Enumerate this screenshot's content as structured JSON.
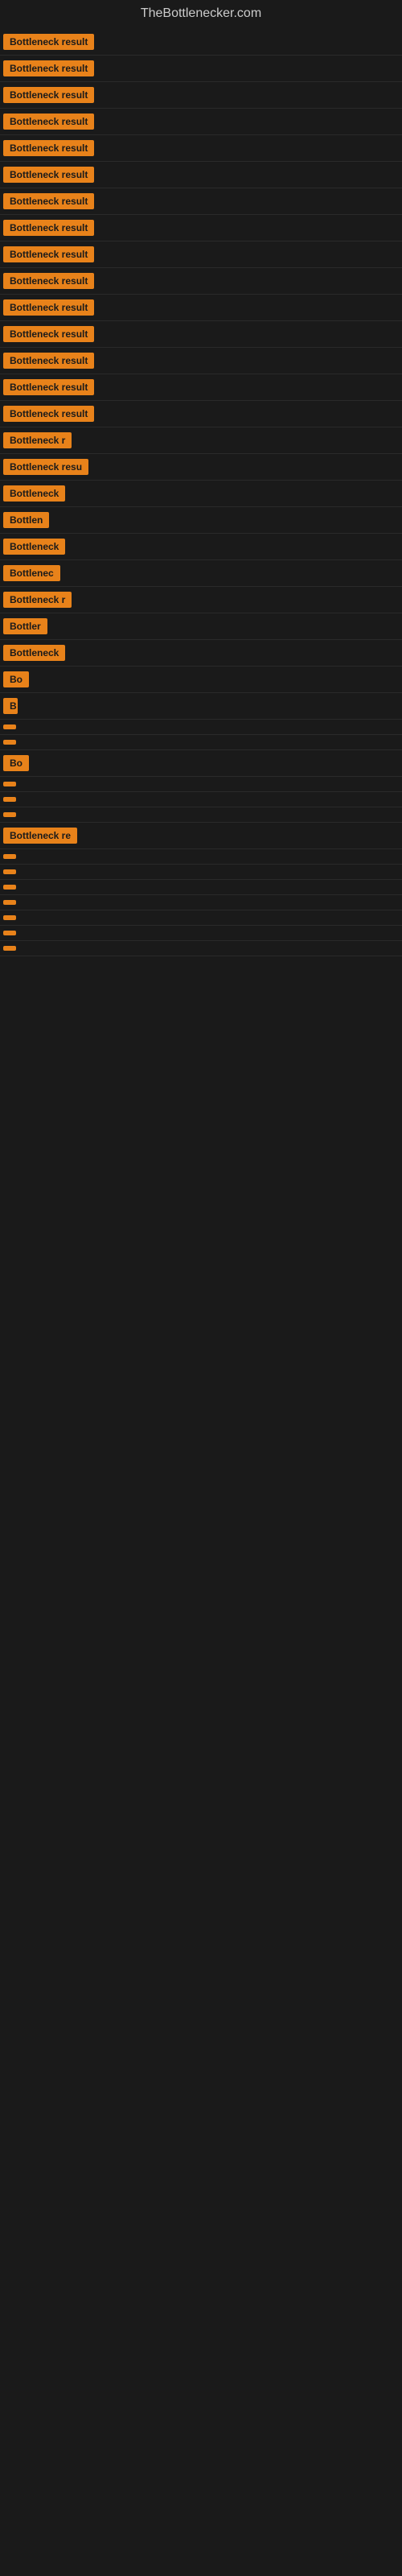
{
  "site": {
    "title": "TheBottlenecker.com"
  },
  "rows": [
    {
      "id": 1,
      "label": "Bottleneck result",
      "badge_class": "badge-full"
    },
    {
      "id": 2,
      "label": "Bottleneck result",
      "badge_class": "badge-full"
    },
    {
      "id": 3,
      "label": "Bottleneck result",
      "badge_class": "badge-full"
    },
    {
      "id": 4,
      "label": "Bottleneck result",
      "badge_class": "badge-full"
    },
    {
      "id": 5,
      "label": "Bottleneck result",
      "badge_class": "badge-full"
    },
    {
      "id": 6,
      "label": "Bottleneck result",
      "badge_class": "badge-full"
    },
    {
      "id": 7,
      "label": "Bottleneck result",
      "badge_class": "badge-full"
    },
    {
      "id": 8,
      "label": "Bottleneck result",
      "badge_class": "badge-full"
    },
    {
      "id": 9,
      "label": "Bottleneck result",
      "badge_class": "badge-full"
    },
    {
      "id": 10,
      "label": "Bottleneck result",
      "badge_class": "badge-full"
    },
    {
      "id": 11,
      "label": "Bottleneck result",
      "badge_class": "badge-full"
    },
    {
      "id": 12,
      "label": "Bottleneck result",
      "badge_class": "badge-full"
    },
    {
      "id": 13,
      "label": "Bottleneck result",
      "badge_class": "badge-full"
    },
    {
      "id": 14,
      "label": "Bottleneck result",
      "badge_class": "badge-full"
    },
    {
      "id": 15,
      "label": "Bottleneck result",
      "badge_class": "badge-full"
    },
    {
      "id": 16,
      "label": "Bottleneck r",
      "badge_class": "badge-w1"
    },
    {
      "id": 17,
      "label": "Bottleneck resu",
      "badge_class": "badge-w2"
    },
    {
      "id": 18,
      "label": "Bottleneck",
      "badge_class": "badge-w3"
    },
    {
      "id": 19,
      "label": "Bottlen",
      "badge_class": "badge-w4"
    },
    {
      "id": 20,
      "label": "Bottleneck",
      "badge_class": "badge-w3"
    },
    {
      "id": 21,
      "label": "Bottlenec",
      "badge_class": "badge-w4"
    },
    {
      "id": 22,
      "label": "Bottleneck r",
      "badge_class": "badge-w1"
    },
    {
      "id": 23,
      "label": "Bottler",
      "badge_class": "badge-w5"
    },
    {
      "id": 24,
      "label": "Bottleneck",
      "badge_class": "badge-w3"
    },
    {
      "id": 25,
      "label": "Bo",
      "badge_class": "badge-w9"
    },
    {
      "id": 26,
      "label": "B",
      "badge_class": "badge-w14"
    },
    {
      "id": 27,
      "label": "",
      "badge_class": "badge-w15"
    },
    {
      "id": 28,
      "label": "",
      "badge_class": "badge-w15"
    },
    {
      "id": 29,
      "label": "Bo",
      "badge_class": "badge-w9"
    },
    {
      "id": 30,
      "label": "",
      "badge_class": "badge-w15"
    },
    {
      "id": 31,
      "label": "",
      "badge_class": "badge-w15"
    },
    {
      "id": 32,
      "label": "",
      "badge_class": "badge-w15"
    },
    {
      "id": 33,
      "label": "Bottleneck re",
      "badge_class": "badge-w2"
    },
    {
      "id": 34,
      "label": "",
      "badge_class": "badge-w15"
    },
    {
      "id": 35,
      "label": "",
      "badge_class": "badge-w15"
    },
    {
      "id": 36,
      "label": "",
      "badge_class": "badge-w15"
    },
    {
      "id": 37,
      "label": "",
      "badge_class": "badge-w15"
    },
    {
      "id": 38,
      "label": "",
      "badge_class": "badge-w15"
    },
    {
      "id": 39,
      "label": "",
      "badge_class": "badge-w15"
    },
    {
      "id": 40,
      "label": "",
      "badge_class": "badge-w15"
    }
  ],
  "colors": {
    "background": "#1a1a1a",
    "badge_bg": "#e8821a",
    "badge_text": "#1a1a1a",
    "title_text": "#cccccc"
  }
}
